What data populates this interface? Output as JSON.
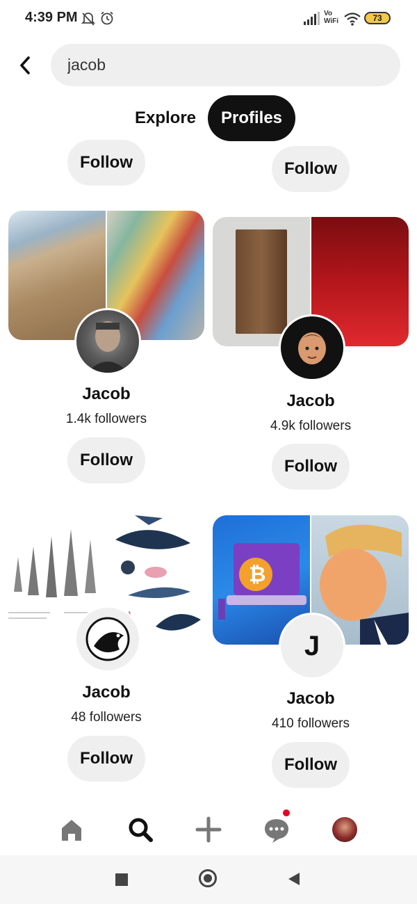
{
  "status_bar": {
    "time": "4:39 PM",
    "network_label": "Vo WiFi",
    "battery": "73"
  },
  "search": {
    "value": "jacob"
  },
  "tabs": [
    {
      "label": "Explore",
      "active": false
    },
    {
      "label": "Profiles",
      "active": true
    }
  ],
  "top_partial": {
    "left_follow": "Follow",
    "right_follow": "Follow"
  },
  "profiles": [
    {
      "name": "Jacob",
      "followers": "1.4k followers",
      "follow_label": "Follow",
      "avatar_icon": "person-photo-icon"
    },
    {
      "name": "Jacob",
      "followers": "4.9k followers",
      "follow_label": "Follow",
      "avatar_icon": "memoji-icon"
    },
    {
      "name": "Jacob",
      "followers": "48 followers",
      "follow_label": "Follow",
      "avatar_icon": "bird-logo-icon"
    },
    {
      "name": "Jacob",
      "followers": "410 followers",
      "follow_label": "Follow",
      "avatar_letter": "J"
    }
  ],
  "bottom_nav": {
    "items": [
      "home-icon",
      "search-icon",
      "add-icon",
      "messages-icon",
      "profile-avatar"
    ],
    "notification_color": "#e60023"
  },
  "colors": {
    "accent_dark": "#111111",
    "pill_bg": "#efefef"
  }
}
